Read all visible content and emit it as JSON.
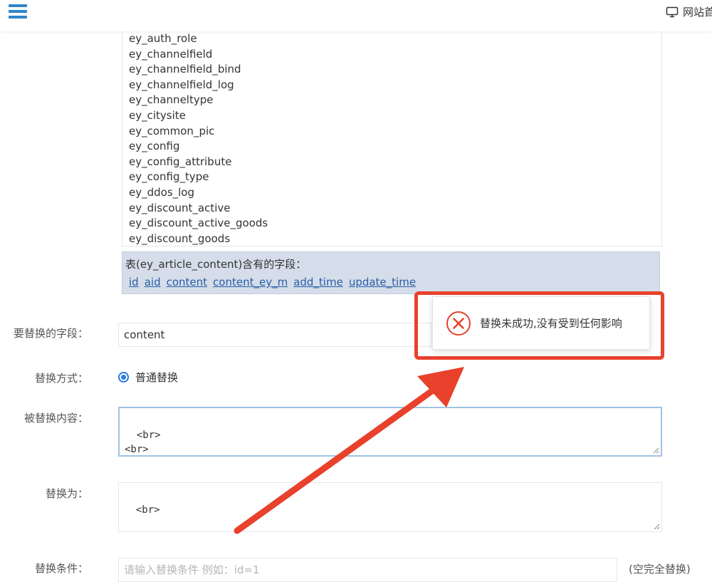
{
  "header": {
    "menu_icon": "hamburger-menu-icon",
    "site_link_label": "网站首",
    "site_link_icon": "monitor-icon"
  },
  "table_list": [
    "ey_auth_role",
    "ey_channelfield",
    "ey_channelfield_bind",
    "ey_channelfield_log",
    "ey_channeltype",
    "ey_citysite",
    "ey_common_pic",
    "ey_config",
    "ey_config_attribute",
    "ey_config_type",
    "ey_ddos_log",
    "ey_discount_active",
    "ey_discount_active_goods",
    "ey_discount_goods"
  ],
  "fields_box": {
    "title": "表(ey_article_content)含有的字段：",
    "fields": [
      "id",
      "aid",
      "content",
      "content_ey_m",
      "add_time",
      "update_time"
    ]
  },
  "form": {
    "replace_field_label": "要替换的字段：",
    "replace_field_value": "content",
    "replace_mode_label": "替换方式：",
    "replace_mode_option": "普通替换",
    "replaced_content_label": "被替换内容：",
    "replaced_content_value": "<br>\n<br>",
    "replace_with_label": "替换为：",
    "replace_with_value": "<br>",
    "condition_label": "替换条件：",
    "condition_placeholder": "请输入替换条件 例如：id=1",
    "condition_hint": "(空完全替换)"
  },
  "toast": {
    "icon": "error-circle-x-icon",
    "message": "替换未成功,没有受到任何影响"
  },
  "colors": {
    "accent_blue": "#2a7be4",
    "link_blue": "#2a5da8",
    "field_box_bg": "#d4dde9",
    "annotation_red": "#e8412c",
    "error_red": "#e8412c"
  }
}
